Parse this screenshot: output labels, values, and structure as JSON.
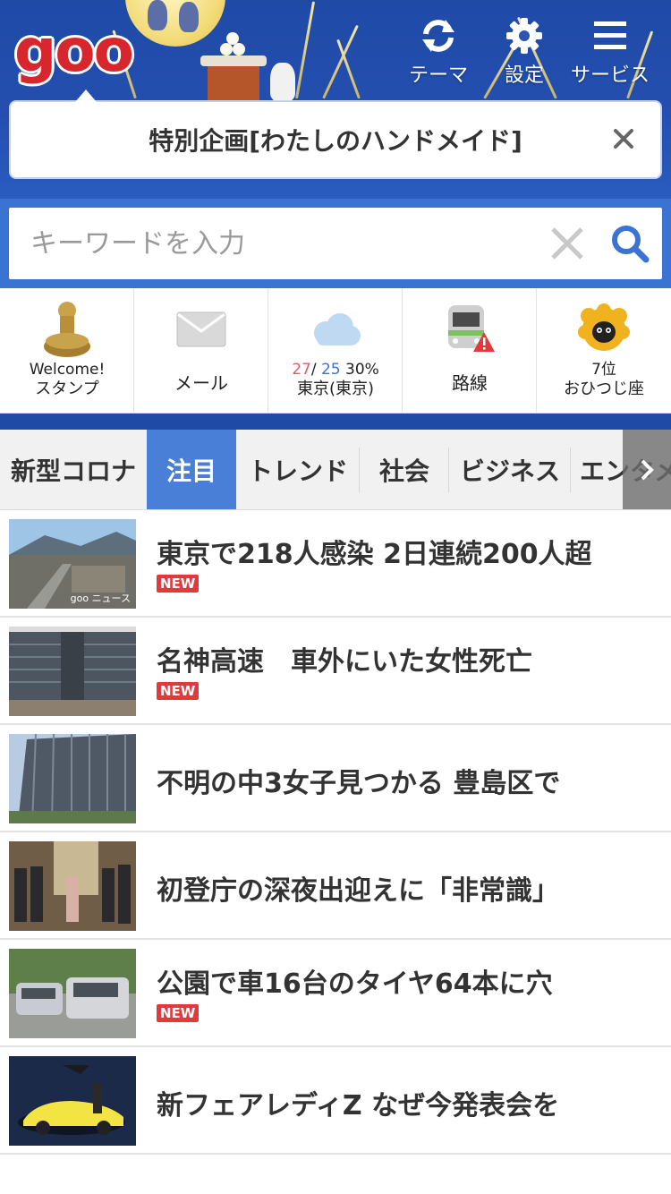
{
  "header": {
    "logo": "goo",
    "theme_label": "テーマ",
    "settings_label": "設定",
    "services_label": "サービス"
  },
  "banner": {
    "text": "特別企画[わたしのハンドメイド]"
  },
  "search": {
    "placeholder": "キーワードを入力"
  },
  "widgets": {
    "stamp": {
      "line1": "Welcome!",
      "line2": "スタンプ"
    },
    "mail": {
      "label": "メール"
    },
    "weather": {
      "high": "27",
      "sep": "/ ",
      "low": "25",
      "rain": " 30%",
      "location": "東京(東京)"
    },
    "train": {
      "label": "路線"
    },
    "horoscope": {
      "rank": "7位",
      "sign": "おひつじ座"
    }
  },
  "tabs": [
    {
      "label": "新型コロナ",
      "active": false
    },
    {
      "label": "注目",
      "active": true
    },
    {
      "label": "トレンド",
      "active": false
    },
    {
      "label": "社会",
      "active": false
    },
    {
      "label": "ビジネス",
      "active": false
    },
    {
      "label": "エンタメ",
      "active": false
    }
  ],
  "new_label": "NEW",
  "news": [
    {
      "title": "東京で218人感染 2日連続200人超",
      "is_new": true,
      "watermark": "goo ニュース"
    },
    {
      "title": "名神高速　車外にいた女性死亡",
      "is_new": true
    },
    {
      "title": "不明の中3女子見つかる 豊島区で",
      "is_new": false
    },
    {
      "title": "初登庁の深夜出迎えに「非常識」",
      "is_new": false
    },
    {
      "title": "公園で車16台のタイヤ64本に穴",
      "is_new": true
    },
    {
      "title": "新フェアレディZ なぜ今発表会を",
      "is_new": false
    }
  ],
  "colors": {
    "header_blue": "#244fb0",
    "accent_blue": "#3b73d3",
    "active_tab": "#4a7fd8",
    "logo_red": "#d8262e",
    "new_badge": "#e23a3a"
  }
}
